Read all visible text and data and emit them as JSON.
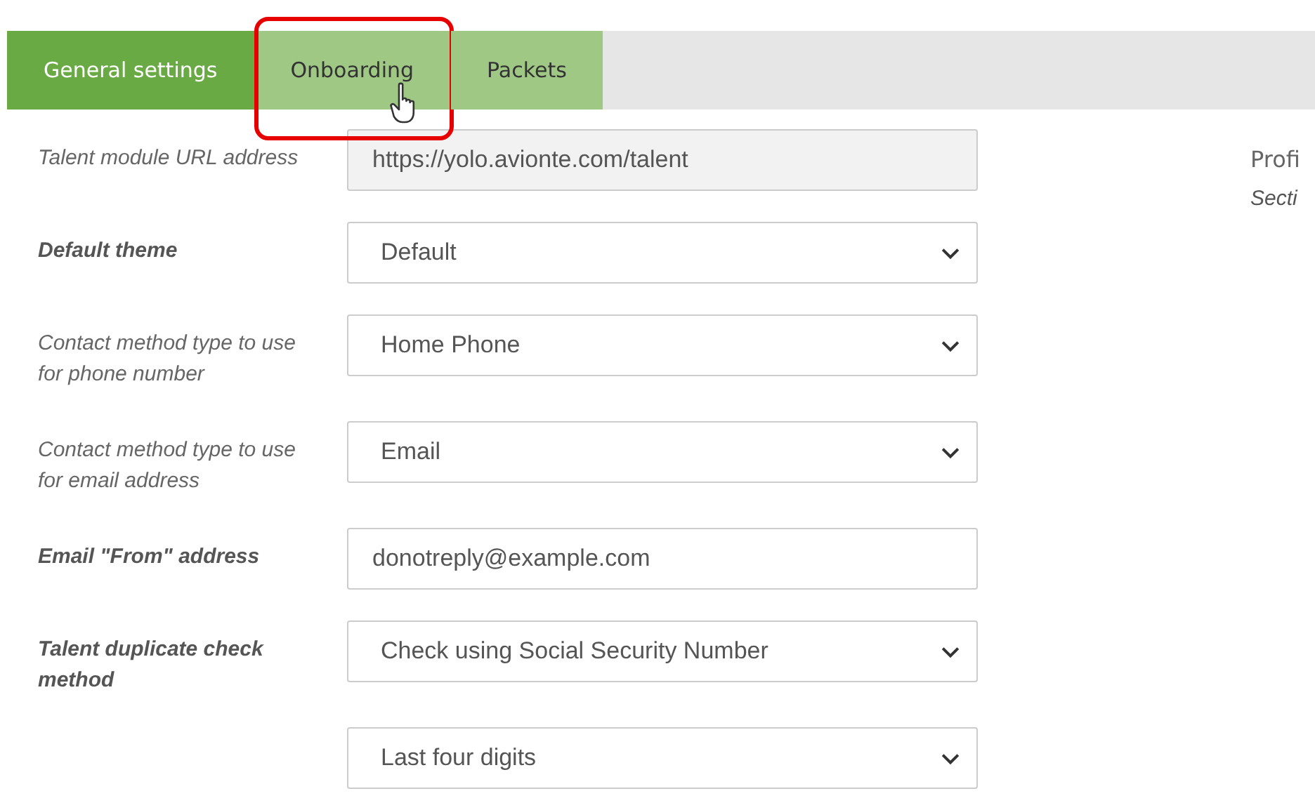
{
  "tabs": [
    {
      "label": "General settings",
      "selected": true,
      "highlighted": false,
      "hovered": false
    },
    {
      "label": "Onboarding",
      "selected": false,
      "highlighted": true,
      "hovered": true
    },
    {
      "label": "Packets",
      "selected": false,
      "highlighted": false,
      "hovered": false
    }
  ],
  "form": [
    {
      "label": "Talent module URL address",
      "emphasis": false,
      "kind": "text",
      "value": "https://yolo.avionte.com/talent",
      "disabled": true
    },
    {
      "label": "Default theme",
      "emphasis": true,
      "kind": "select",
      "value": "Default",
      "disabled": false
    },
    {
      "label": "Contact method type to use for phone number",
      "emphasis": false,
      "kind": "select",
      "value": "Home Phone",
      "disabled": false
    },
    {
      "label": "Contact method type to use for email address",
      "emphasis": false,
      "kind": "select",
      "value": "Email",
      "disabled": false
    },
    {
      "label": "Email \"From\" address",
      "emphasis": true,
      "kind": "text",
      "value": "donotreply@example.com",
      "disabled": false
    },
    {
      "label": "Talent duplicate check method",
      "emphasis": true,
      "kind": "select",
      "value": "Check using Social Security Number",
      "disabled": false
    },
    {
      "kind": "select",
      "value": "Last four digits",
      "disabled": false
    }
  ],
  "side_panel": {
    "title": "Profi",
    "subtitle": "Secti"
  }
}
